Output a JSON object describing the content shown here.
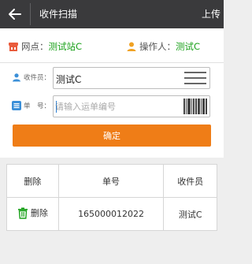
{
  "titlebar": {
    "title": "收件扫描",
    "upload_label": "上传"
  },
  "info": {
    "site_label": "网点：",
    "site_value": "测试站C",
    "operator_label": "操作人：",
    "operator_value": "测试C"
  },
  "form": {
    "courier_label": "收件员：",
    "courier_value": "测试C",
    "order_label": "单　号：",
    "order_value": "",
    "order_placeholder": "请输入运单编号",
    "confirm_label": "确定"
  },
  "table": {
    "headers": [
      "删除",
      "单号",
      "收件员"
    ],
    "rows": [
      {
        "delete_label": "删除",
        "order_no": "165000012022",
        "courier": "测试C"
      }
    ]
  },
  "colors": {
    "titlebar": "#3a3a3c",
    "accent_green": "#1aa11a",
    "confirm_orange": "#ef7d17"
  },
  "icons": [
    "back-arrow-icon",
    "store-icon",
    "person-icon",
    "list-menu-icon",
    "barcode-scan-icon",
    "trash-icon"
  ]
}
